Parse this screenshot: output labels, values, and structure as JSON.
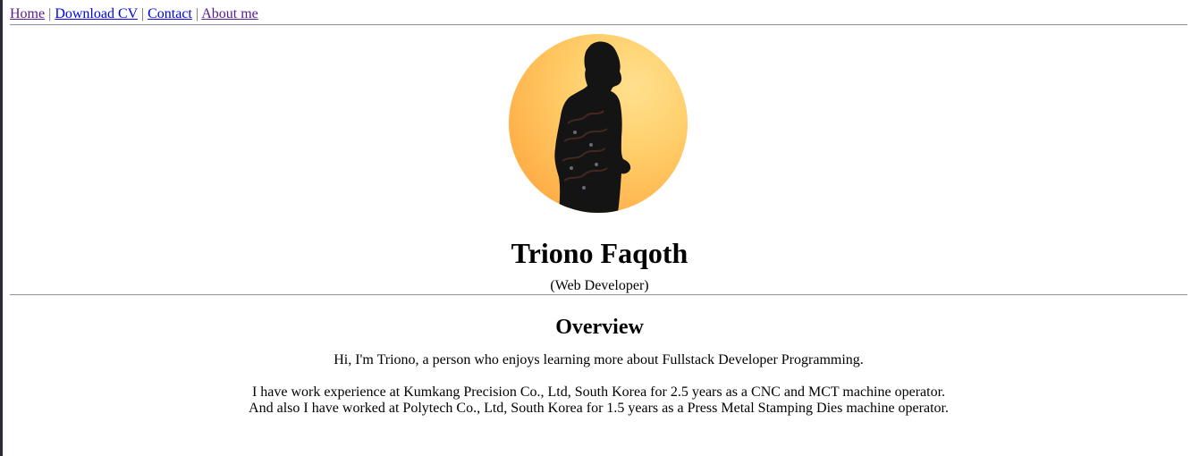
{
  "nav": {
    "items": [
      {
        "label": "Home",
        "visited": true
      },
      {
        "label": "Download CV",
        "visited": false
      },
      {
        "label": "Contact",
        "visited": false
      },
      {
        "label": "About me",
        "visited": true
      }
    ],
    "separator": "|"
  },
  "profile": {
    "name": "Triono Faqoth",
    "role": "(Web Developer)"
  },
  "overview": {
    "heading": "Overview",
    "intro": "Hi, I'm Triono, a person who enjoys learning more about Fullstack Developer Programming.",
    "experience_line1": "I have work experience at Kumkang Precision Co., Ltd, South Korea for 2.5 years as a CNC and MCT machine operator.",
    "experience_line2": "And also I have worked at Polytech Co., Ltd, South Korea for 1.5 years as a Press Metal Stamping Dies machine operator."
  },
  "colors": {
    "link": "#0000ee",
    "visited_link": "#551a8b",
    "avatar_bg_light": "#ffe08f",
    "avatar_bg_dark": "#ff9f3a"
  }
}
